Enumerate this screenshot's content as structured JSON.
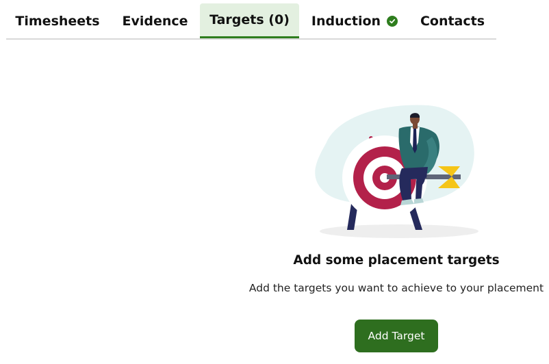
{
  "tabs": [
    {
      "label": "Timesheets",
      "active": false
    },
    {
      "label": "Evidence",
      "active": false
    },
    {
      "label": "Targets (0)",
      "active": true
    },
    {
      "label": "Induction",
      "active": false,
      "status_icon": "check-circle-icon"
    },
    {
      "label": "Contacts",
      "active": false
    }
  ],
  "empty_state": {
    "illustration": "target-businessman-illustration",
    "title": "Add some placement targets",
    "description": "Add the targets you want to achieve to your placement",
    "button_label": "Add Target"
  },
  "colors": {
    "accent": "#2e6e1f",
    "active_tab_bg": "#e3f0e0",
    "target_red": "#b3214a",
    "arrow_yellow": "#f5c518"
  }
}
